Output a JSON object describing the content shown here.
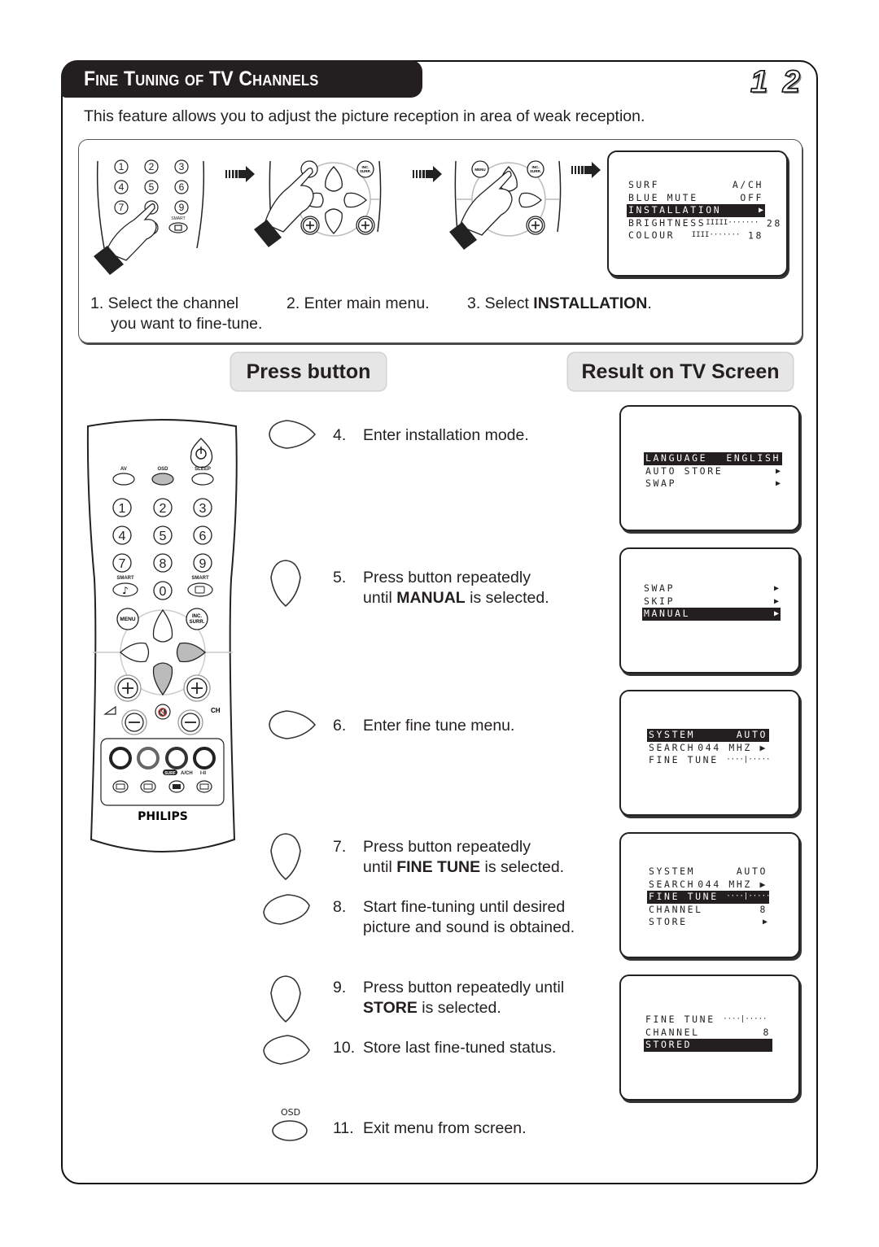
{
  "header": {
    "title": "Fine Tuning of TV Channels",
    "page_number": "1 2"
  },
  "intro": "This feature allows you to adjust the picture reception in area of weak reception.",
  "preliminary_steps": [
    {
      "line1": "1. Select the channel",
      "line2": "you want to fine-tune."
    },
    {
      "line1": "2. Enter main menu."
    },
    {
      "prefix": "3. Select ",
      "bold": "INSTALLATION",
      "suffix": "."
    }
  ],
  "preliminary_illustrations": {
    "keypad_labels": [
      "1",
      "2",
      "3",
      "4",
      "5",
      "6",
      "7",
      "8",
      "9",
      "0"
    ],
    "smart_label": "SMART",
    "menu_label": "MENU",
    "inc_surr_label": "INC. SURR."
  },
  "main_menu_screen": {
    "rows": [
      {
        "label": "SURF",
        "value": "A/CH",
        "selected": false
      },
      {
        "label": "BLUE MUTE",
        "value": "OFF",
        "selected": false
      },
      {
        "label": "INSTALLATION",
        "value": "▶",
        "selected": true
      },
      {
        "label": "BRIGHTNESS",
        "bar": "IIIII·······",
        "value": "28",
        "selected": false
      },
      {
        "label": "COLOUR",
        "bar": "IIII·······",
        "value": "18",
        "selected": false
      }
    ]
  },
  "column_headers": {
    "press_button": "Press button",
    "result_on_tv": "Result on TV Screen"
  },
  "remote": {
    "top_labels": [
      "AV",
      "OSD",
      "SLEEP"
    ],
    "digits": [
      "1",
      "2",
      "3",
      "4",
      "5",
      "6",
      "7",
      "8",
      "9",
      "0"
    ],
    "smart_left": "SMART",
    "smart_right": "SMART",
    "menu": "MENU",
    "inc_surr_1": "INC.",
    "inc_surr_2": "SURR.",
    "ch": "CH",
    "surf": "SURF",
    "ach": "A/CH",
    "i_ii": "I-II",
    "brand": "PHILIPS"
  },
  "instructions": [
    {
      "num": "4.",
      "text": "Enter installation mode.",
      "button": "right"
    },
    {
      "num": "5.",
      "line1": "Press button repeatedly",
      "prefix": "until ",
      "bold": "MANUAL",
      "suffix": " is selected.",
      "button": "down"
    },
    {
      "num": "6.",
      "text": "Enter fine tune menu.",
      "button": "right"
    },
    {
      "num": "7.",
      "line1": "Press button repeatedly",
      "prefix": "until ",
      "bold": "FINE TUNE",
      "suffix": " is selected.",
      "button": "down"
    },
    {
      "num": "8.",
      "line1": "Start fine-tuning until desired",
      "line2": "picture and sound is obtained.",
      "button": "left-right"
    },
    {
      "num": "9.",
      "line1": "Press button repeatedly until",
      "bold": "STORE",
      "suffix": " is selected.",
      "button": "down"
    },
    {
      "num": "10.",
      "text": "Store last fine-tuned status.",
      "button": "right"
    },
    {
      "num": "11.",
      "text": "Exit menu from screen.",
      "button": "osd",
      "button_label": "OSD"
    }
  ],
  "tv_screens": [
    {
      "rows": [
        {
          "label": "LANGUAGE",
          "value": "ENGLISH",
          "selected": true
        },
        {
          "label": "AUTO STORE",
          "value": "▶",
          "selected": false
        },
        {
          "label": "SWAP",
          "value": "▶",
          "selected": false
        }
      ]
    },
    {
      "rows": [
        {
          "label": "SWAP",
          "value": "▶",
          "selected": false
        },
        {
          "label": "SKIP",
          "value": "▶",
          "selected": false
        },
        {
          "label": "MANUAL",
          "value": "▶",
          "selected": true
        }
      ]
    },
    {
      "rows": [
        {
          "label": "SYSTEM",
          "value": "AUTO",
          "selected": true
        },
        {
          "label": "SEARCH",
          "value": "044 MHZ ▶",
          "selected": false
        },
        {
          "label": "FINE TUNE",
          "bar": "····|·····",
          "value": "",
          "selected": false
        }
      ]
    },
    {
      "rows": [
        {
          "label": "SYSTEM",
          "value": "AUTO",
          "selected": false
        },
        {
          "label": "SEARCH",
          "value": "044 MHZ ▶",
          "selected": false
        },
        {
          "label": "FINE TUNE",
          "bar": "····|·····",
          "value": "",
          "selected": true
        },
        {
          "label": "CHANNEL",
          "value": "8",
          "selected": false
        },
        {
          "label": "STORE",
          "value": "▶",
          "selected": false
        }
      ]
    },
    {
      "rows": [
        {
          "label": "FINE TUNE",
          "bar": "····|·····",
          "value": "",
          "selected": false
        },
        {
          "label": "CHANNEL",
          "value": "8",
          "selected": false
        },
        {
          "label": "STORED",
          "value": "",
          "selected": true
        }
      ]
    }
  ]
}
